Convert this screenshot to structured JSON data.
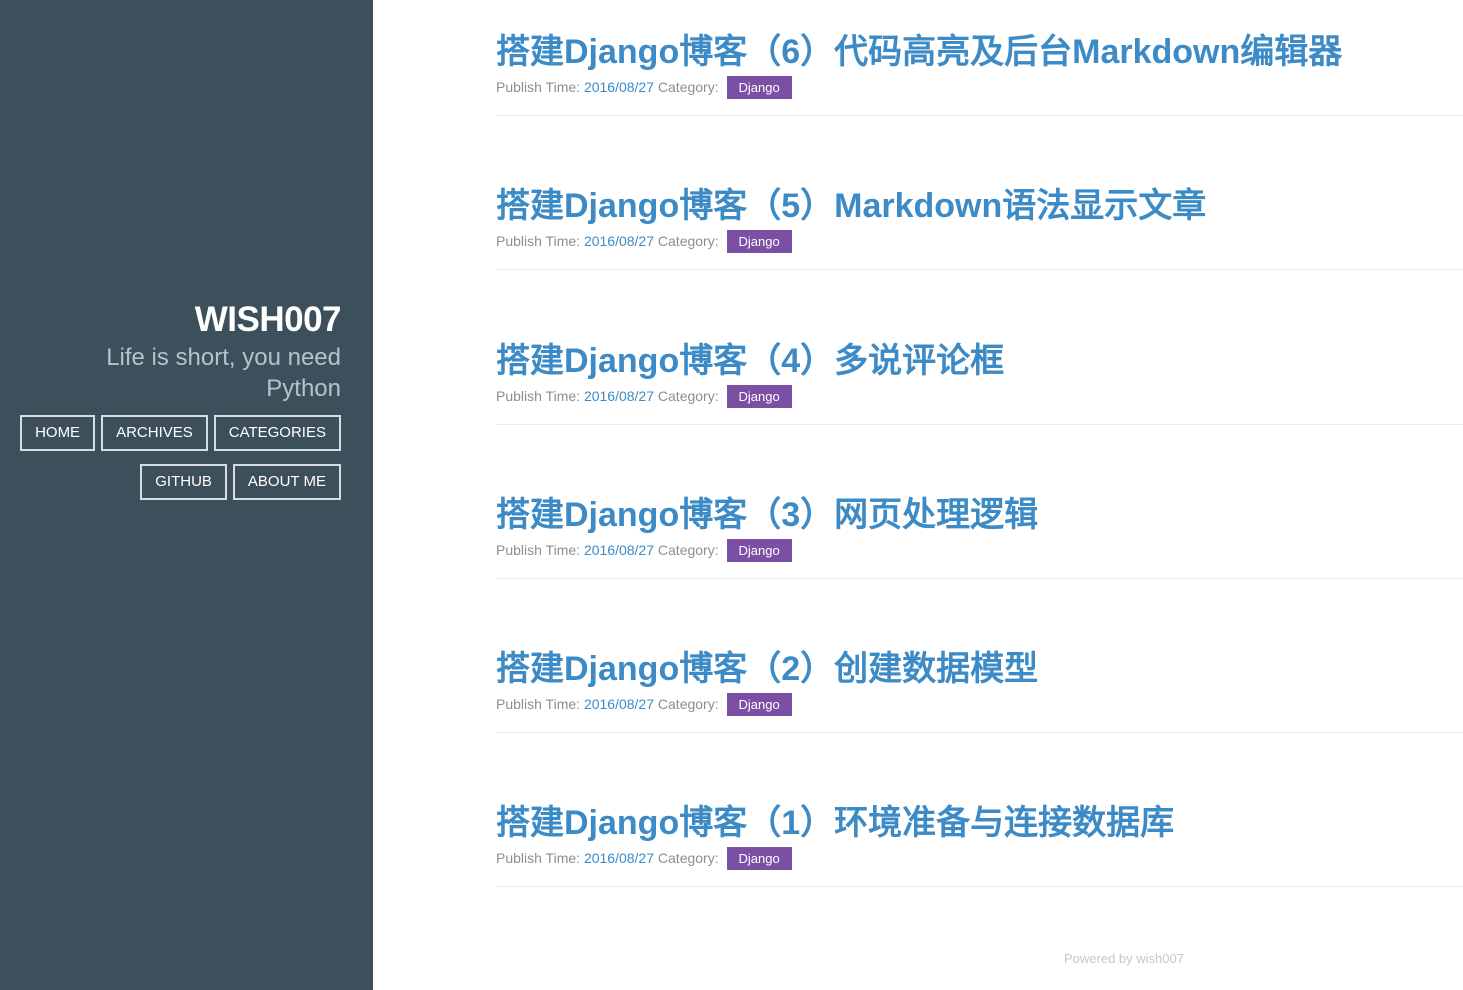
{
  "sidebar": {
    "title": "WISH007",
    "tagline_line1": "Life is short, you need",
    "tagline_line2": "Python",
    "nav": {
      "home": "HOME",
      "archives": "ARCHIVES",
      "categories": "CATEGORIES",
      "github": "GITHUB",
      "about": "ABOUT ME"
    }
  },
  "meta_labels": {
    "publish": "Publish Time: ",
    "category": " Category: "
  },
  "posts": [
    {
      "title": "搭建Django博客（6）代码高亮及后台Markdown编辑器",
      "date": "2016/08/27",
      "category": "Django"
    },
    {
      "title": "搭建Django博客（5）Markdown语法显示文章",
      "date": "2016/08/27",
      "category": "Django"
    },
    {
      "title": "搭建Django博客（4）多说评论框",
      "date": "2016/08/27",
      "category": "Django"
    },
    {
      "title": "搭建Django博客（3）网页处理逻辑",
      "date": "2016/08/27",
      "category": "Django"
    },
    {
      "title": "搭建Django博客（2）创建数据模型",
      "date": "2016/08/27",
      "category": "Django"
    },
    {
      "title": "搭建Django博客（1）环境准备与连接数据库",
      "date": "2016/08/27",
      "category": "Django"
    }
  ],
  "footer": "Powered by wish007",
  "colors": {
    "sidebar_bg": "#3e4f5c",
    "link": "#3d8bc6",
    "badge": "#7b4fa3"
  }
}
